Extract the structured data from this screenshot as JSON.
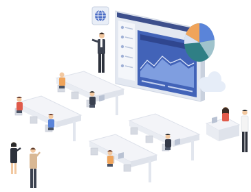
{
  "colors": {
    "screen_frame": "#dfe5ef",
    "screen_header": "#3d4f8c",
    "screen_panel": "#3f5db0",
    "chart_blue": "#6c8fd6",
    "pie_teal": "#2f7f85",
    "pie_orange": "#f0a45a",
    "pie_blue": "#5a84d9",
    "pie_light": "#d7e2f4",
    "cloud": "#e8eef8",
    "desk": "#f1f3f7",
    "chair": "#cfd3db",
    "skin": "#f2c8a0"
  },
  "icons": {
    "globe": "globe-icon",
    "cloud": "cloud-icon",
    "pie_chart": "pie-chart-icon"
  }
}
